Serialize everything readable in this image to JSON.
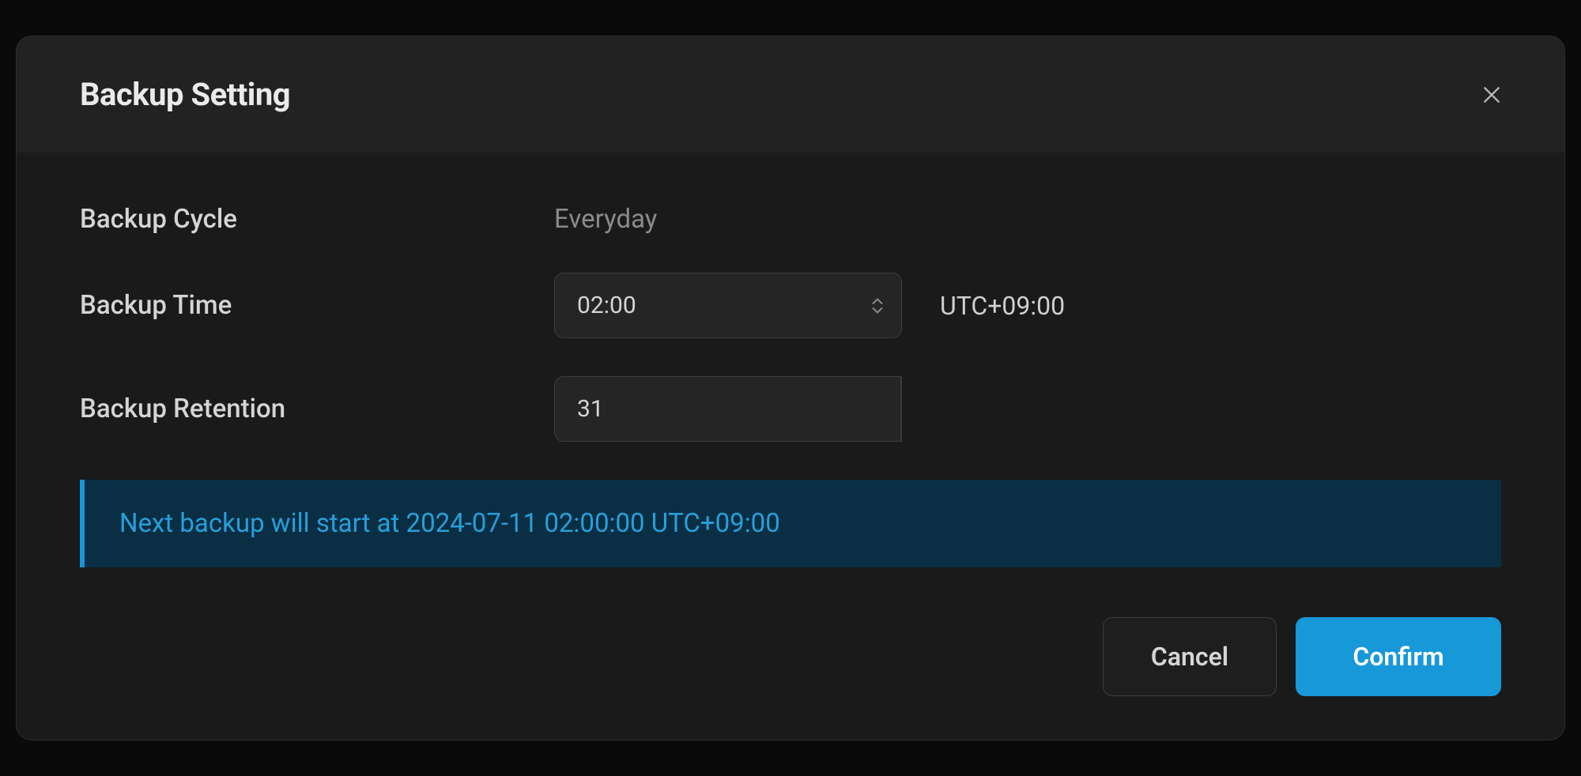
{
  "modal": {
    "title": "Backup Setting"
  },
  "form": {
    "backup_cycle": {
      "label": "Backup Cycle",
      "value": "Everyday"
    },
    "backup_time": {
      "label": "Backup Time",
      "value": "02:00",
      "timezone": "UTC+09:00"
    },
    "backup_retention": {
      "label": "Backup Retention",
      "value": "31"
    }
  },
  "banner": {
    "text": "Next backup will start at 2024-07-11 02:00:00 UTC+09:00"
  },
  "footer": {
    "cancel_label": "Cancel",
    "confirm_label": "Confirm"
  },
  "colors": {
    "accent": "#1698d9",
    "banner_bg": "#0a2e44"
  }
}
